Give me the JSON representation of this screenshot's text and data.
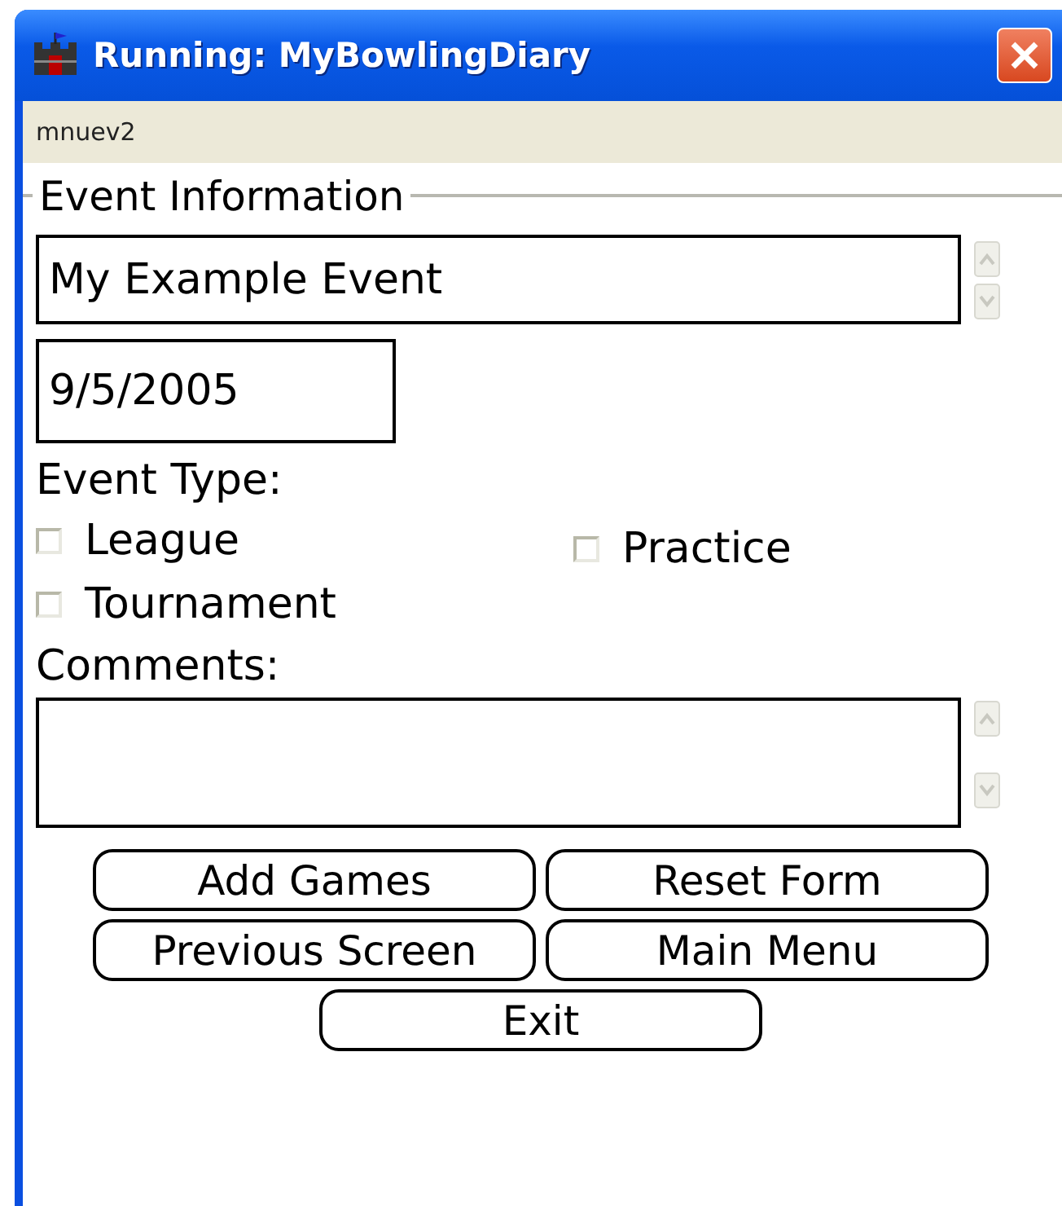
{
  "window": {
    "title": "Running: MyBowlingDiary"
  },
  "menu_bar": {
    "label": "mnuev2"
  },
  "form": {
    "group_title": "Event Information",
    "name_field": {
      "value": "My Example Event"
    },
    "date_field": {
      "value": "9/5/2005"
    },
    "event_type_label": "Event Type:",
    "event_types": [
      {
        "label": "League",
        "checked": false
      },
      {
        "label": "Practice",
        "checked": false
      },
      {
        "label": "Tournament",
        "checked": false
      }
    ],
    "comments_label": "Comments:"
  },
  "buttons": [
    {
      "label": "Add Games"
    },
    {
      "label": "Reset Form"
    },
    {
      "label": "Previous Screen"
    },
    {
      "label": "Main Menu"
    },
    {
      "label": "Exit"
    }
  ]
}
